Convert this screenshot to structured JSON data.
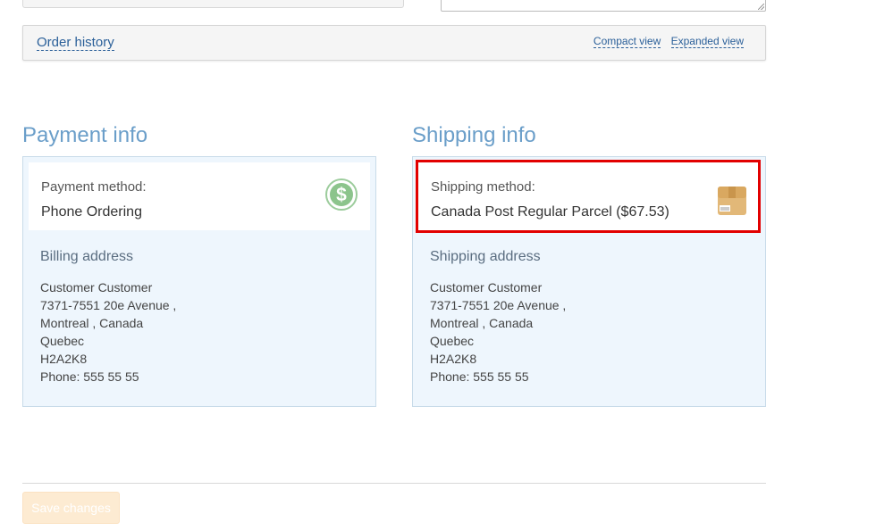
{
  "order_history": {
    "label": "Order history",
    "compact_view": "Compact view",
    "expanded_view": "Expanded view"
  },
  "payment": {
    "title": "Payment info",
    "method_label": "Payment method:",
    "method_value": "Phone Ordering",
    "method_icon": "dollar-icon",
    "address_title": "Billing address",
    "address_lines": [
      "Customer Customer",
      "7371-7551 20e Avenue ,",
      "Montreal , Canada",
      "Quebec",
      "H2A2K8",
      "Phone: 555 55 55"
    ]
  },
  "shipping": {
    "title": "Shipping info",
    "method_label": "Shipping method:",
    "method_value": "Canada Post Regular Parcel ($67.53)",
    "method_icon": "package-icon",
    "address_title": "Shipping address",
    "address_lines": [
      "Customer Customer",
      "7371-7551 20e Avenue ,",
      "Montreal , Canada",
      "Quebec",
      "H2A2K8",
      "Phone: 555 55 55"
    ]
  },
  "actions": {
    "save_label": "Save changes"
  },
  "colors": {
    "section_title": "#6a9ec9",
    "link": "#2a5f99",
    "panel_bg": "#eef6fd",
    "highlight": "#e20000",
    "save_button_bg": "#fdebd2"
  }
}
